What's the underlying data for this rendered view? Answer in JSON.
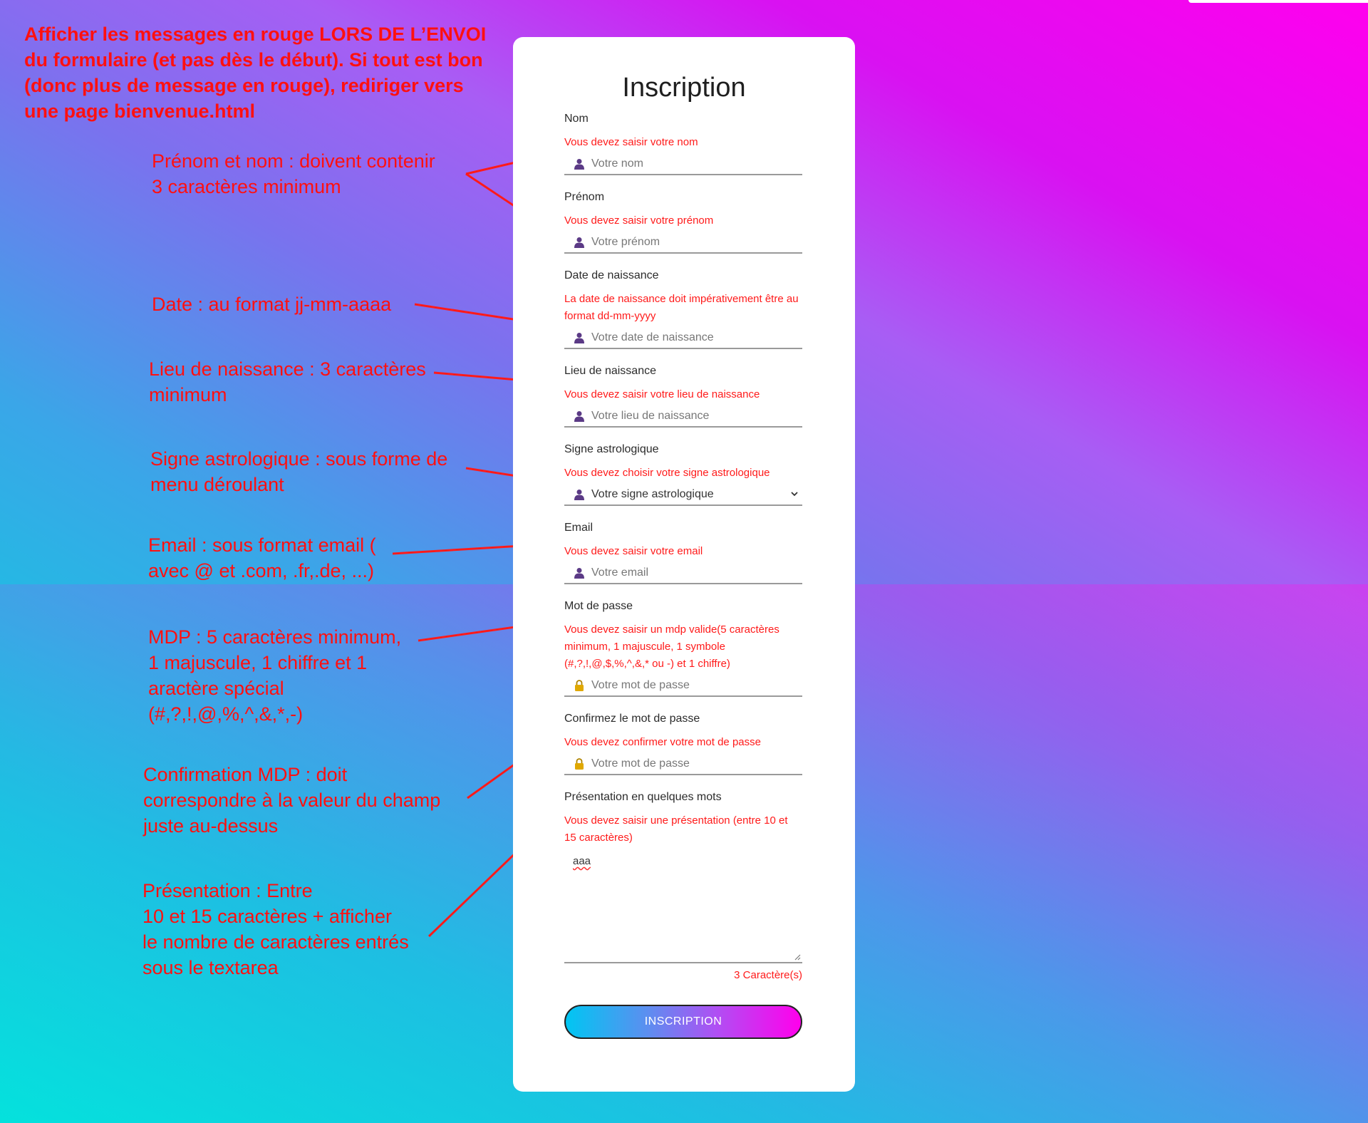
{
  "instructions": {
    "main": [
      "Afficher les messages en rouge LORS DE L’ENVOI",
      "du formulaire (et pas dès le début). Si tout est bon",
      "(donc plus de message en rouge), rediriger vers",
      "une page bienvenue.html"
    ],
    "names": [
      "Prénom et nom : doivent contenir",
      "3 caractères minimum"
    ],
    "date": [
      "Date : au format jj-mm-aaaa"
    ],
    "lieu": [
      "Lieu de naissance : 3 caractères",
      "minimum"
    ],
    "signe": [
      "Signe astrologique : sous forme de",
      "menu déroulant"
    ],
    "email": [
      "Email : sous format email (",
      "avec @ et .com, .fr,.de, ...)"
    ],
    "mdp": [
      "MDP : 5 caractères minimum,",
      "1 majuscule, 1 chiffre et 1",
      "aractère spécial",
      "(#,?,!,@,%,^,&,*,-)"
    ],
    "confirm": [
      "Confirmation MDP :  doit",
      "correspondre à la valeur du champ",
      "juste au-dessus"
    ],
    "presentation": [
      "Présentation : Entre",
      "10 et 15 caractères + afficher",
      "le nombre de caractères entrés",
      "sous le textarea"
    ]
  },
  "form": {
    "title": "Inscription",
    "nom": {
      "label": "Nom",
      "error": "Vous devez saisir votre nom",
      "placeholder": "Votre nom"
    },
    "prenom": {
      "label": "Prénom",
      "error": "Vous devez saisir votre prénom",
      "placeholder": "Votre prénom"
    },
    "date": {
      "label": "Date de naissance",
      "error": "La date de naissance doit impérativement être au format dd-mm-yyyy",
      "placeholder": "Votre date de naissance"
    },
    "lieu": {
      "label": "Lieu de naissance",
      "error": "Vous devez saisir votre lieu de naissance",
      "placeholder": "Votre lieu de naissance"
    },
    "signe": {
      "label": "Signe astrologique",
      "error": "Vous devez choisir votre signe astrologique",
      "selected": "Votre signe astrologique"
    },
    "email": {
      "label": "Email",
      "error": "Vous devez saisir votre email",
      "placeholder": "Votre email"
    },
    "mdp": {
      "label": "Mot de passe",
      "error": "Vous devez saisir un mdp valide(5 caractères minimum, 1 majuscule, 1 symbole (#,?,!,@,$,%,^,&,* ou -) et 1 chiffre)",
      "placeholder": "Votre mot de passe"
    },
    "confirm": {
      "label": "Confirmez le mot de passe",
      "error": "Vous devez confirmer votre mot de passe",
      "placeholder": "Votre mot de passe"
    },
    "presentation": {
      "label": "Présentation en quelques mots",
      "error": "Vous devez saisir une présentation (entre 10 et 15 caractères)",
      "value": "aaa",
      "count": "3 Caractère(s)"
    },
    "submit": "INSCRIPTION"
  },
  "icons": {
    "user": "user-icon",
    "lock": "lock-icon",
    "chevron": "chevron-down-icon"
  },
  "colors": {
    "error": "#ff1a1a",
    "annotation": "#ff1010",
    "user_icon": "#5b3a86",
    "lock_icon": "#e0a800"
  }
}
